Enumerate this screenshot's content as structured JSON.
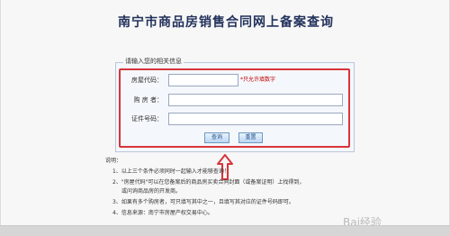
{
  "page": {
    "title": "南宁市商品房销售合同网上备案查询",
    "form_legend": "请输入您的相关信息",
    "fields": [
      {
        "label": "房屋代码：",
        "value": ""
      },
      {
        "label": "购 房 者：",
        "value": ""
      },
      {
        "label": "证件号码：",
        "value": ""
      }
    ],
    "hint": "*只允许填数字",
    "buttons": {
      "query": "查询",
      "reset": "重置"
    },
    "notes": {
      "title": "说明：",
      "items": [
        "1、以上三个条件必须同时一起输入才能够查询！",
        "2、\"房屋代码\"可以在您备案后的商品房买卖合同封面（或备案证明）上找得到，",
        "或问询商品房的开发商。",
        "3、如果有多个购房者，可只填写其中之一，且填写其对应的证件号码即可。",
        "4、信息来源：南宁市房屋产权交易中心。"
      ]
    },
    "watermark": "Bai经验"
  },
  "colors": {
    "title": "#23325c",
    "highlight": "#d7353b",
    "hint": "#c00000"
  }
}
